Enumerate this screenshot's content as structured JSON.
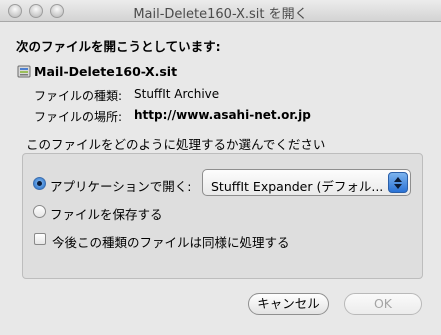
{
  "window": {
    "title": "Mail-Delete160-X.sit を開く"
  },
  "dialog": {
    "heading": "次のファイルを開こうとしています:",
    "file_name": "Mail-Delete160-X.sit",
    "file_icon": "archive-file-icon",
    "kind_label": "ファイルの種類:",
    "kind_value": "StuffIt Archive",
    "from_label": "ファイルの場所:",
    "from_value": "http://www.asahi-net.or.jp",
    "section_label": "このファイルをどのように処理するか選んでください",
    "options": {
      "open_with_label": "アプリケーションで開く:",
      "open_with_selected": true,
      "open_with_app": "StuffIt Expander (デフォル...",
      "save_label": "ファイルを保存する",
      "save_selected": false
    },
    "remember_label": "今後この種類のファイルは同様に処理する",
    "remember_checked": false
  },
  "buttons": {
    "cancel": "キャンセル",
    "ok": "OK",
    "ok_enabled": false
  }
}
